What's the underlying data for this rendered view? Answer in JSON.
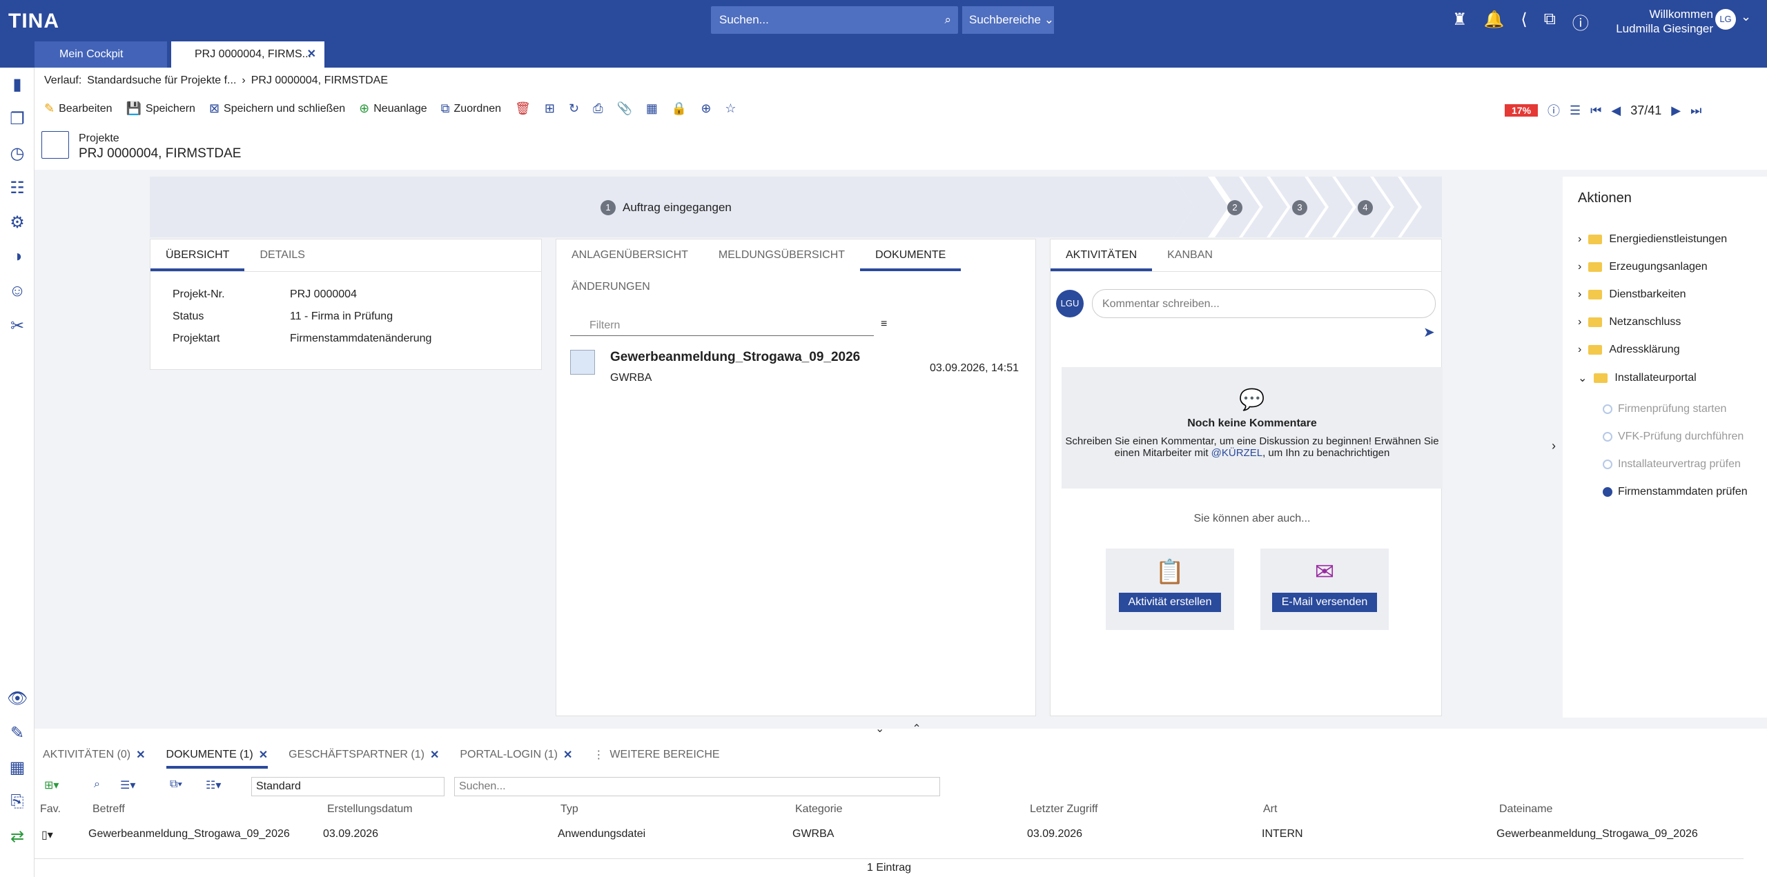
{
  "app": {
    "logo": "TINA",
    "search_placeholder": "Suchen...",
    "search_areas": "Suchbereiche",
    "welcome": "Willkommen",
    "user": "Ludmilla Giesinger",
    "user_initials": "LG"
  },
  "tabs": [
    {
      "label": "Mein Cockpit"
    },
    {
      "label": "PRJ 0000004, FIRMS..."
    }
  ],
  "breadcrumb": {
    "label": "Verlauf:",
    "items": [
      "Standardsuche für Projekte f...",
      "PRJ 0000004, FIRMSTDAE"
    ]
  },
  "toolbar": {
    "edit": "Bearbeiten",
    "save": "Speichern",
    "save_close": "Speichern und schließen",
    "new": "Neuanlage",
    "assign": "Zuordnen",
    "percent": "17%",
    "record": "37/41"
  },
  "header": {
    "category": "Projekte",
    "title": "PRJ 0000004, FIRMSTDAE"
  },
  "process": {
    "step1_num": "1",
    "step1_label": "Auftrag eingegangen",
    "steps": [
      "2",
      "3",
      "4"
    ]
  },
  "overview": {
    "tabs": [
      "ÜBERSICHT",
      "DETAILS"
    ],
    "fields": [
      {
        "k": "Projekt-Nr.",
        "v": "PRJ 0000004"
      },
      {
        "k": "Status",
        "v": "11 - Firma in Prüfung"
      },
      {
        "k": "Projektart",
        "v": "Firmenstammdatenänderung"
      }
    ]
  },
  "documents": {
    "tabs": [
      "ANLAGENÜBERSICHT",
      "MELDUNGSÜBERSICHT",
      "DOKUMENTE",
      "ÄNDERUNGEN"
    ],
    "filter": "Filtern",
    "doc_title": "Gewerbeanmeldung_Strogawa_09_2026",
    "doc_sub": "GWRBA",
    "doc_date": "03.09.2026, 14:51"
  },
  "activities": {
    "tabs": [
      "AKTIVITÄTEN",
      "KANBAN"
    ],
    "avatar": "LGU",
    "comment_placeholder": "Kommentar schreiben...",
    "no_comments": "Noch keine Kommentare",
    "hint1": "Schreiben Sie einen Kommentar, um eine Diskussion zu beginnen! Erwähnen Sie",
    "hint2a": "einen Mitarbeiter mit ",
    "hint2b": "@KÜRZEL",
    "hint2c": ", um Ihn zu benachrichtigen",
    "can_also": "Sie können aber auch...",
    "btn_activity": "Aktivität erstellen",
    "btn_email": "E-Mail versenden"
  },
  "actions": {
    "title": "Aktionen",
    "folders": [
      "Energiedienstleistungen",
      "Erzeugungsanlagen",
      "Dienstbarkeiten",
      "Netzanschluss",
      "Adressklärung",
      "Installateurportal"
    ],
    "subitems": [
      "Firmenprüfung starten",
      "VFK-Prüfung durchführen",
      "Installateurvertrag prüfen",
      "Firmenstammdaten prüfen"
    ]
  },
  "bottom": {
    "tabs": [
      "AKTIVITÄTEN (0)",
      "DOKUMENTE (1)",
      "GESCHÄFTSPARTNER (1)",
      "PORTAL-LOGIN (1)",
      "WEITERE BEREICHE"
    ],
    "view": "Standard",
    "search": "Suchen...",
    "columns": [
      "Fav.",
      "Betreff",
      "Erstellungsdatum",
      "Typ",
      "Kategorie",
      "Letzter Zugriff",
      "Art",
      "Dateiname"
    ],
    "row": [
      "Gewerbeanmeldung_Strogawa_09_2026",
      "03.09.2026",
      "Anwendungsdatei",
      "GWRBA",
      "03.09.2026",
      "INTERN",
      "Gewerbeanmeldung_Strogawa_09_2026"
    ],
    "footer": "1 Eintrag"
  }
}
